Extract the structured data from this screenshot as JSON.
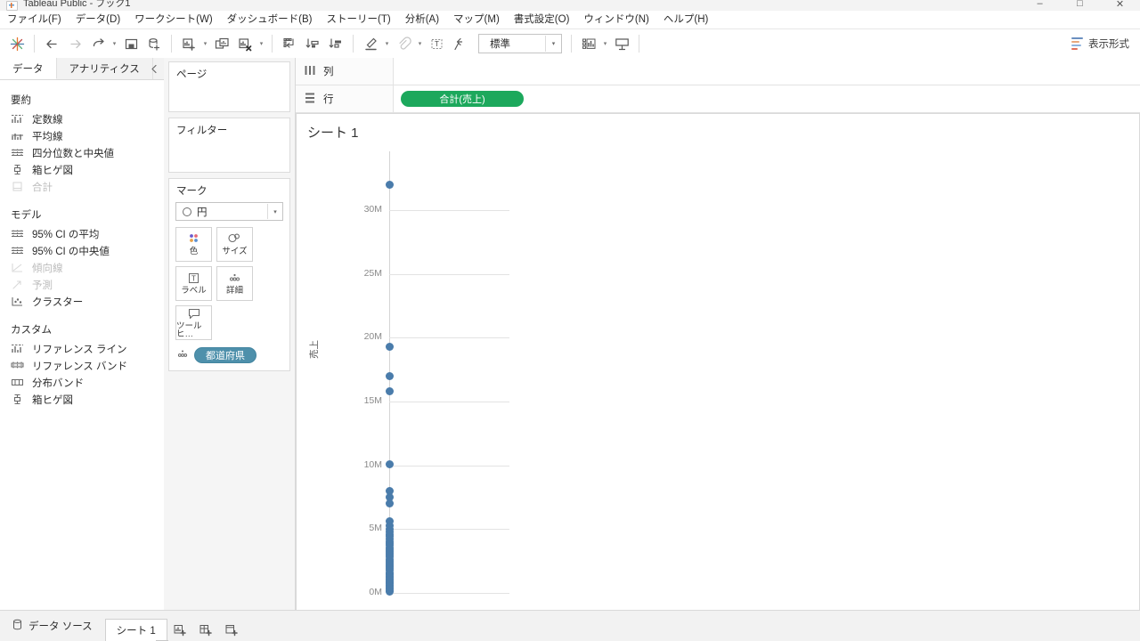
{
  "window": {
    "title": "Tableau Public - ブック1",
    "app_icon": "tableau-logo-icon",
    "minimize": "–",
    "maximize": "□",
    "close": "✕"
  },
  "menubar": {
    "items": [
      {
        "label": "ファイル(F)",
        "name": "menu-file"
      },
      {
        "label": "データ(D)",
        "name": "menu-data"
      },
      {
        "label": "ワークシート(W)",
        "name": "menu-worksheet"
      },
      {
        "label": "ダッシュボード(B)",
        "name": "menu-dashboard"
      },
      {
        "label": "ストーリー(T)",
        "name": "menu-story"
      },
      {
        "label": "分析(A)",
        "name": "menu-analysis"
      },
      {
        "label": "マップ(M)",
        "name": "menu-map"
      },
      {
        "label": "書式設定(O)",
        "name": "menu-format"
      },
      {
        "label": "ウィンドウ(N)",
        "name": "menu-window"
      },
      {
        "label": "ヘルプ(H)",
        "name": "menu-help"
      }
    ]
  },
  "toolbar": {
    "home_icon": "tableau-home-icon",
    "back_icon": "back-arrow-icon",
    "forward_icon": "forward-arrow-icon",
    "undo_redo_icon": "redo-arrow-icon",
    "save_icon": "save-icon",
    "new_data_source_icon": "new-data-source-icon",
    "new_worksheet_icon": "new-worksheet-icon",
    "duplicate_sheet_icon": "duplicate-sheet-icon",
    "clear_sheet_icon": "clear-sheet-icon",
    "swap_icon": "swap-rows-columns-icon",
    "sort_asc_icon": "sort-ascending-icon",
    "sort_desc_icon": "sort-descending-icon",
    "highlight_icon": "highlight-icon",
    "group_icon": "group-members-icon",
    "labels_icon": "show-mark-labels-icon",
    "fix_axes_icon": "fix-axes-icon",
    "presentation_icon": "presentation-mode-icon",
    "fit_select_value": "標準",
    "fit_select_caret": "▾",
    "show_me_label": "表示形式",
    "show_me_icon": "show-me-icon"
  },
  "left_pane": {
    "tabs": [
      {
        "label": "データ",
        "name": "tab-data",
        "active": true
      },
      {
        "label": "アナリティクス",
        "name": "tab-analytics",
        "active": false
      }
    ],
    "collapse_icon": "chevron-left-icon",
    "sections": [
      {
        "title": "要約",
        "name": "section-summarize",
        "items": [
          {
            "label": "定数線",
            "icon": "constant-line-icon",
            "disabled": false
          },
          {
            "label": "平均線",
            "icon": "average-line-icon",
            "disabled": false
          },
          {
            "label": "四分位数と中央値",
            "icon": "median-quartiles-icon",
            "disabled": false
          },
          {
            "label": "箱ヒゲ図",
            "icon": "box-plot-icon",
            "disabled": false
          },
          {
            "label": "合計",
            "icon": "totals-icon",
            "disabled": true
          }
        ]
      },
      {
        "title": "モデル",
        "name": "section-model",
        "items": [
          {
            "label": "95% CI の平均",
            "icon": "average-ci-icon",
            "disabled": false
          },
          {
            "label": "95% CI の中央値",
            "icon": "median-ci-icon",
            "disabled": false
          },
          {
            "label": "傾向線",
            "icon": "trend-line-icon",
            "disabled": true
          },
          {
            "label": "予測",
            "icon": "forecast-icon",
            "disabled": true
          },
          {
            "label": "クラスター",
            "icon": "cluster-icon",
            "disabled": false
          }
        ]
      },
      {
        "title": "カスタム",
        "name": "section-custom",
        "items": [
          {
            "label": "リファレンス ライン",
            "icon": "reference-line-icon",
            "disabled": false
          },
          {
            "label": "リファレンス バンド",
            "icon": "reference-band-icon",
            "disabled": false
          },
          {
            "label": "分布バンド",
            "icon": "distribution-band-icon",
            "disabled": false
          },
          {
            "label": "箱ヒゲ図",
            "icon": "box-plot-icon",
            "disabled": false
          }
        ]
      }
    ]
  },
  "cards": {
    "pages": {
      "title": "ページ",
      "name": "card-pages"
    },
    "filters": {
      "title": "フィルター",
      "name": "card-filters"
    },
    "marks": {
      "title": "マーク",
      "mark_type": "円",
      "mark_type_icon": "circle-mark-icon",
      "mark_type_caret": "▾",
      "buttons": [
        {
          "label": "色",
          "icon": "color-icon",
          "name": "marks-color-button"
        },
        {
          "label": "サイズ",
          "icon": "size-icon",
          "name": "marks-size-button"
        },
        {
          "label": "ラベル",
          "icon": "label-icon",
          "name": "marks-label-button"
        },
        {
          "label": "詳細",
          "icon": "detail-icon",
          "name": "marks-detail-button"
        },
        {
          "label": "ツールヒ…",
          "icon": "tooltip-icon",
          "name": "marks-tooltip-button"
        }
      ],
      "pills": [
        {
          "label": "都道府県",
          "icon": "detail-icon",
          "name": "marks-pill-prefecture"
        }
      ]
    }
  },
  "shelves": {
    "columns": {
      "label": "列",
      "icon": "columns-icon",
      "pills": []
    },
    "rows": {
      "label": "行",
      "icon": "rows-icon",
      "pills": [
        {
          "label": "合計(売上)",
          "color": "#1ca85c"
        }
      ]
    }
  },
  "view": {
    "title": "シート 1"
  },
  "status_bar": {
    "data_source_label": "データ ソース",
    "data_source_icon": "data-source-icon",
    "sheet_tab": "シート 1",
    "new_worksheet_icon": "new-worksheet-icon",
    "new_dashboard_icon": "new-dashboard-icon",
    "new_story_icon": "new-story-icon"
  },
  "colors": {
    "mark_blue": "#4a7cab",
    "pill_green": "#1ca85c",
    "pill_blue": "#4e90ab",
    "accent_orange": "#e8762d"
  },
  "chart_data": {
    "type": "scatter",
    "title": "シート 1",
    "xlabel": "",
    "ylabel": "売上",
    "ylim": [
      0,
      33000000
    ],
    "ytick_labels": [
      "0M",
      "5M",
      "10M",
      "15M",
      "20M",
      "25M",
      "30M"
    ],
    "ytick_values": [
      0,
      5000000,
      10000000,
      15000000,
      20000000,
      25000000,
      30000000
    ],
    "grid": true,
    "legend_position": "none",
    "mark_type": "circle",
    "mark_color": "#4a7cab",
    "detail_field": "都道府県",
    "measure_field": "合計(売上)",
    "series": [
      {
        "name": "合計(売上)",
        "values": [
          32000000,
          19300000,
          17000000,
          15800000,
          10100000,
          8000000,
          7500000,
          7000000,
          5600000,
          5300000,
          5000000,
          4800000,
          4600000,
          4400000,
          4200000,
          4000000,
          3850000,
          3700000,
          3550000,
          3400000,
          3250000,
          3100000,
          2950000,
          2800000,
          2650000,
          2500000,
          2350000,
          2200000,
          2050000,
          1900000,
          1750000,
          1600000,
          1500000,
          1400000,
          1300000,
          1200000,
          1100000,
          1000000,
          900000,
          800000,
          700000,
          600000,
          500000,
          400000,
          300000,
          200000,
          120000
        ]
      }
    ]
  }
}
